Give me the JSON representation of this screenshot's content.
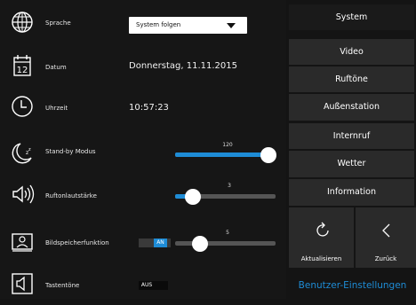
{
  "settings": {
    "language": {
      "label": "Sprache",
      "value": "System folgen"
    },
    "date": {
      "label": "Datum",
      "value": "Donnerstag, 11.11.2015"
    },
    "time": {
      "label": "Uhrzeit",
      "value": "10:57:23"
    },
    "standby": {
      "label": "Stand-by Modus",
      "value": "120",
      "fraction": 1.0
    },
    "ringtone_volume": {
      "label": "Ruftonlautstärke",
      "value": "3",
      "fraction": 0.18
    },
    "image_memory": {
      "label": "Bildspeicherfunktion",
      "value": "5",
      "fraction": 0.25,
      "toggle": "AN"
    },
    "key_tones": {
      "label": "Tastentöne",
      "toggle": "AUS"
    }
  },
  "menu": {
    "system": "System",
    "video": "Video",
    "ringtones": "Ruftöne",
    "outdoor": "Außenstation",
    "intercom": "Internruf",
    "weather": "Wetter",
    "information": "Information",
    "refresh": "Aktualisieren",
    "back": "Zurück",
    "footer": "Benutzer-Einstellungen"
  },
  "colors": {
    "accent": "#1e8cd6",
    "background": "#161616",
    "button": "#2a2a2a"
  },
  "icons": [
    "globe-icon",
    "calendar-icon",
    "clock-icon",
    "moon-sleep-icon",
    "speaker-volume-icon",
    "image-memory-icon",
    "key-tone-icon",
    "refresh-icon",
    "chevron-left-icon"
  ]
}
